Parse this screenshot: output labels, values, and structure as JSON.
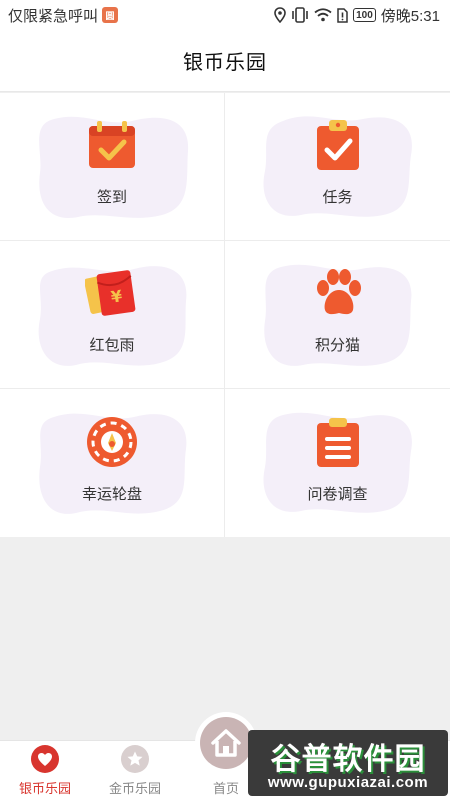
{
  "status_bar": {
    "left_text": "仅限紧急呼叫",
    "sim_badge": "圆",
    "battery": "100",
    "time": "傍晚5:31"
  },
  "header": {
    "title": "银币乐园"
  },
  "grid_items": [
    {
      "label": "签到",
      "icon": "calendar-check-icon"
    },
    {
      "label": "任务",
      "icon": "clipboard-check-icon"
    },
    {
      "label": "红包雨",
      "icon": "red-envelope-icon"
    },
    {
      "label": "积分猫",
      "icon": "paw-icon"
    },
    {
      "label": "幸运轮盘",
      "icon": "wheel-icon"
    },
    {
      "label": "问卷调查",
      "icon": "survey-icon"
    }
  ],
  "tabbar": {
    "tabs": [
      {
        "label": "银币乐园",
        "icon": "heart-icon",
        "active": true
      },
      {
        "label": "金币乐园",
        "icon": "star-icon",
        "active": false
      },
      {
        "label": "首页",
        "icon": "home-icon",
        "active": false
      }
    ]
  },
  "watermark": {
    "title": "谷普软件园",
    "url": "www.gupuxiazai.com"
  },
  "colors": {
    "accent": "#d8352e",
    "icon_orange": "#ee5a2f",
    "blob": "#f4eff9",
    "icon_yellow": "#f5c34a"
  }
}
